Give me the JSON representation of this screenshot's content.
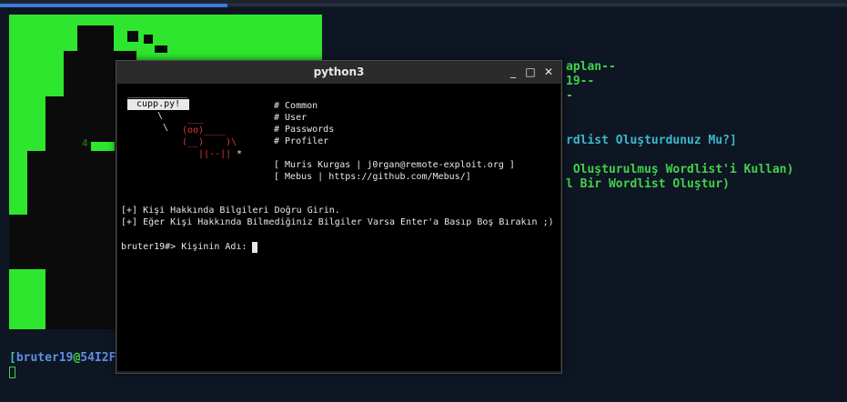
{
  "background_terminal": {
    "lines": [
      {
        "text": "aplan--",
        "color": "green"
      },
      {
        "text": "19--",
        "color": "green"
      },
      {
        "text": "-",
        "color": "green"
      },
      {
        "text": "rdlist Oluşturdunuz Mu?]",
        "color": "cyan"
      },
      {
        "text": " Oluşturulmuş Wordlist'i Kullan)",
        "color": "green"
      },
      {
        "text": "l Bir Wordlist Oluştur)",
        "color": "green"
      }
    ],
    "banner_glyph": "4",
    "prompt": {
      "open": "[",
      "user": "bruter19",
      "at": "@",
      "host": "54I2F"
    }
  },
  "window": {
    "title": "python3",
    "controls": {
      "minimize": "_",
      "maximize": "□",
      "close": "✕"
    },
    "ascii": {
      "rule": "___________",
      "cupp_label": "cupp.py!",
      "line1": "\\",
      "line2": " \\",
      "cow_top": " ___",
      "cow_face": "(oo)____",
      "cow_body": "(__)    )\\",
      "cow_legs": "||--||",
      "star": "*"
    },
    "menu": [
      "# Common",
      "# User",
      "# Passwords",
      "# Profiler"
    ],
    "credits": [
      "[ Muris Kurgas | j0rgan@remote-exploit.org ]",
      "[ Mebus | https://github.com/Mebus/]"
    ],
    "info": [
      "[+] Kişi Hakkında Bilgileri Doğru Girin.",
      "[+] Eğer Kişi Hakkında Bilmediğiniz Bilgiler Varsa Enter'a Basıp Boş Bırakın ;)"
    ],
    "prompt": "bruter19#> Kişinin Adı: "
  }
}
